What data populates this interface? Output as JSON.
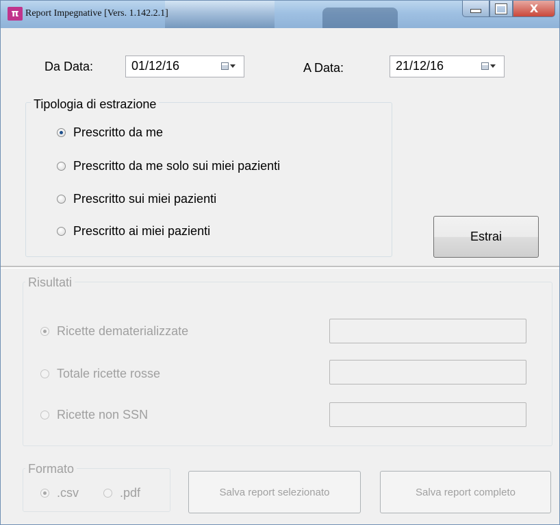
{
  "window": {
    "title": "Report Impegnative [Vers. 1.142.2.1]",
    "app_icon": "pi-icon",
    "app_icon_glyph": "π",
    "close_glyph": "X"
  },
  "dates": {
    "from_label": "Da Data:",
    "from_value": "01/12/16",
    "to_label": "A Data:",
    "to_value": "21/12/16"
  },
  "extraction": {
    "title": "Tipologia di estrazione",
    "options": [
      {
        "label": "Prescritto da me",
        "checked": true
      },
      {
        "label": "Prescritto da me solo sui miei pazienti",
        "checked": false
      },
      {
        "label": "Prescritto sui miei pazienti",
        "checked": false
      },
      {
        "label": "Prescritto ai miei pazienti",
        "checked": false
      }
    ],
    "extract_button": "Estrai"
  },
  "results": {
    "title": "Risultati",
    "options": [
      {
        "label": "Ricette dematerializzate",
        "checked": true,
        "value": ""
      },
      {
        "label": "Totale ricette rosse",
        "checked": false,
        "value": ""
      },
      {
        "label": "Ricette non SSN",
        "checked": false,
        "value": ""
      }
    ]
  },
  "format": {
    "title": "Formato",
    "options": [
      {
        "label": ".csv",
        "checked": true
      },
      {
        "label": ".pdf",
        "checked": false
      }
    ]
  },
  "actions": {
    "save_selected": "Salva report selezionato",
    "save_full": "Salva report completo"
  },
  "colors": {
    "accent_radio": "#1e4f8c",
    "titlebar": "#9fc0e2",
    "close_button": "#c9473a",
    "disabled_text": "#a0a0a0"
  }
}
